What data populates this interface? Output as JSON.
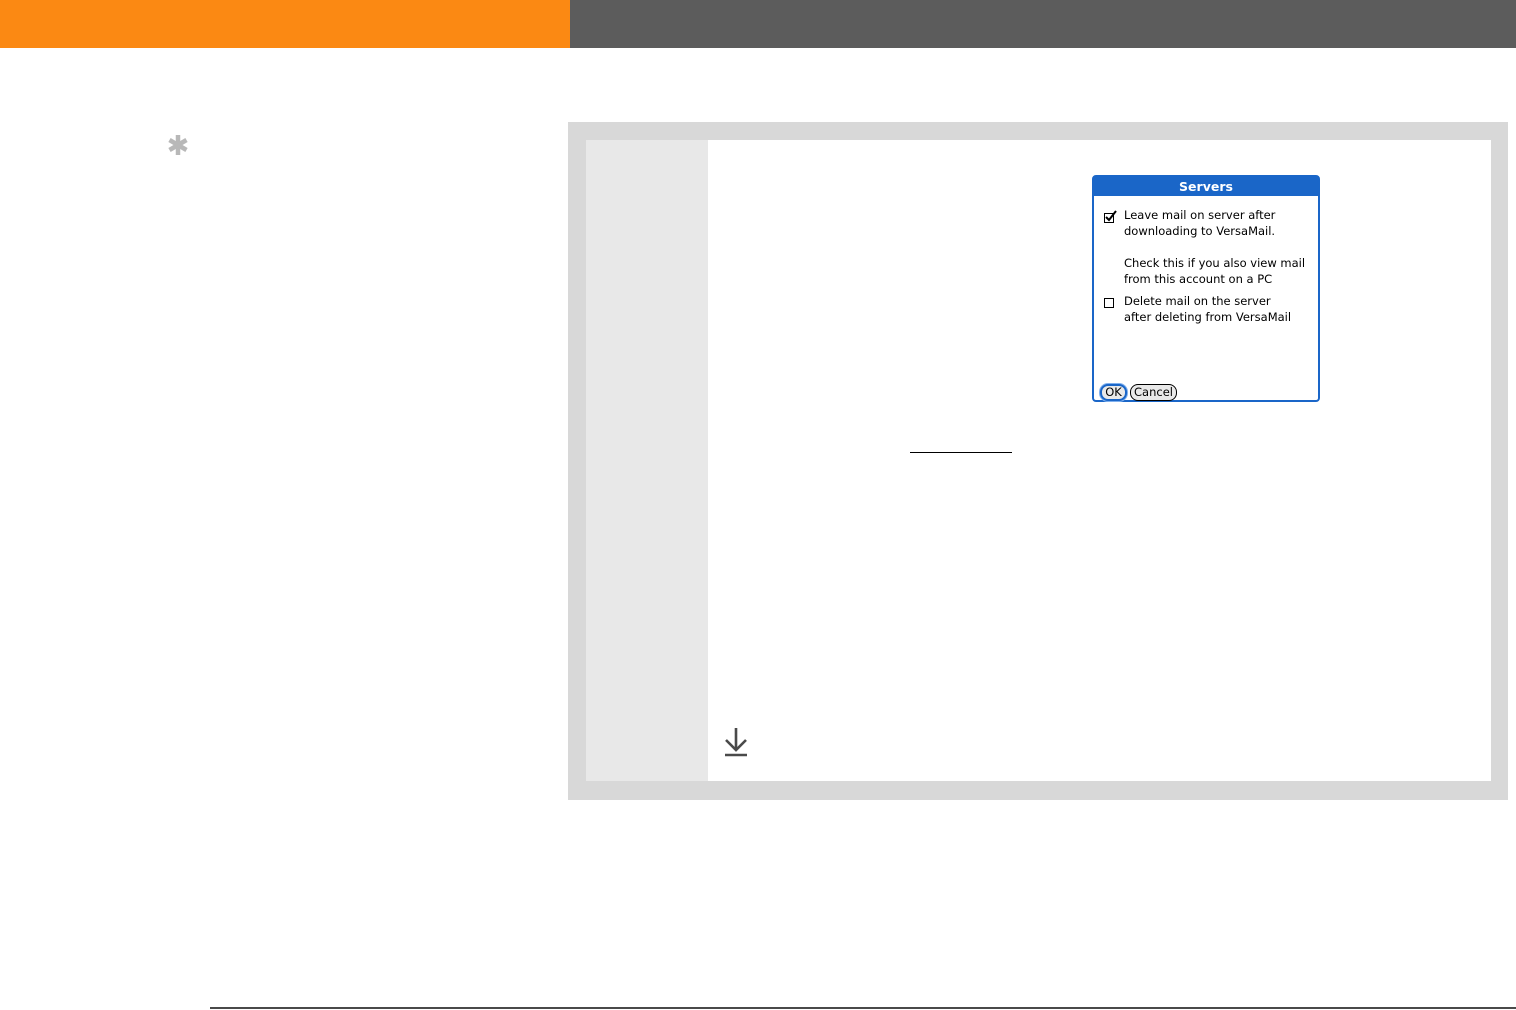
{
  "dialog": {
    "title": "Servers",
    "option_leave": {
      "checked": true,
      "line1": "Leave mail on server after",
      "line2": "downloading to VersaMail."
    },
    "hint": {
      "line1": "Check this if you also view mail",
      "line2": "from this account on a PC"
    },
    "option_delete": {
      "checked": false,
      "line1": "Delete mail on the server",
      "line2": "after deleting from VersaMail"
    },
    "ok_label": "OK",
    "cancel_label": "Cancel"
  },
  "colors": {
    "header_orange": "#fb8913",
    "header_gray": "#5c5c5c",
    "panel_gray": "#d8d8d8",
    "dialog_blue": "#1a66c8"
  },
  "icons": {
    "tip": "asterisk-icon",
    "continue": "down-arrow-to-bar-icon"
  }
}
